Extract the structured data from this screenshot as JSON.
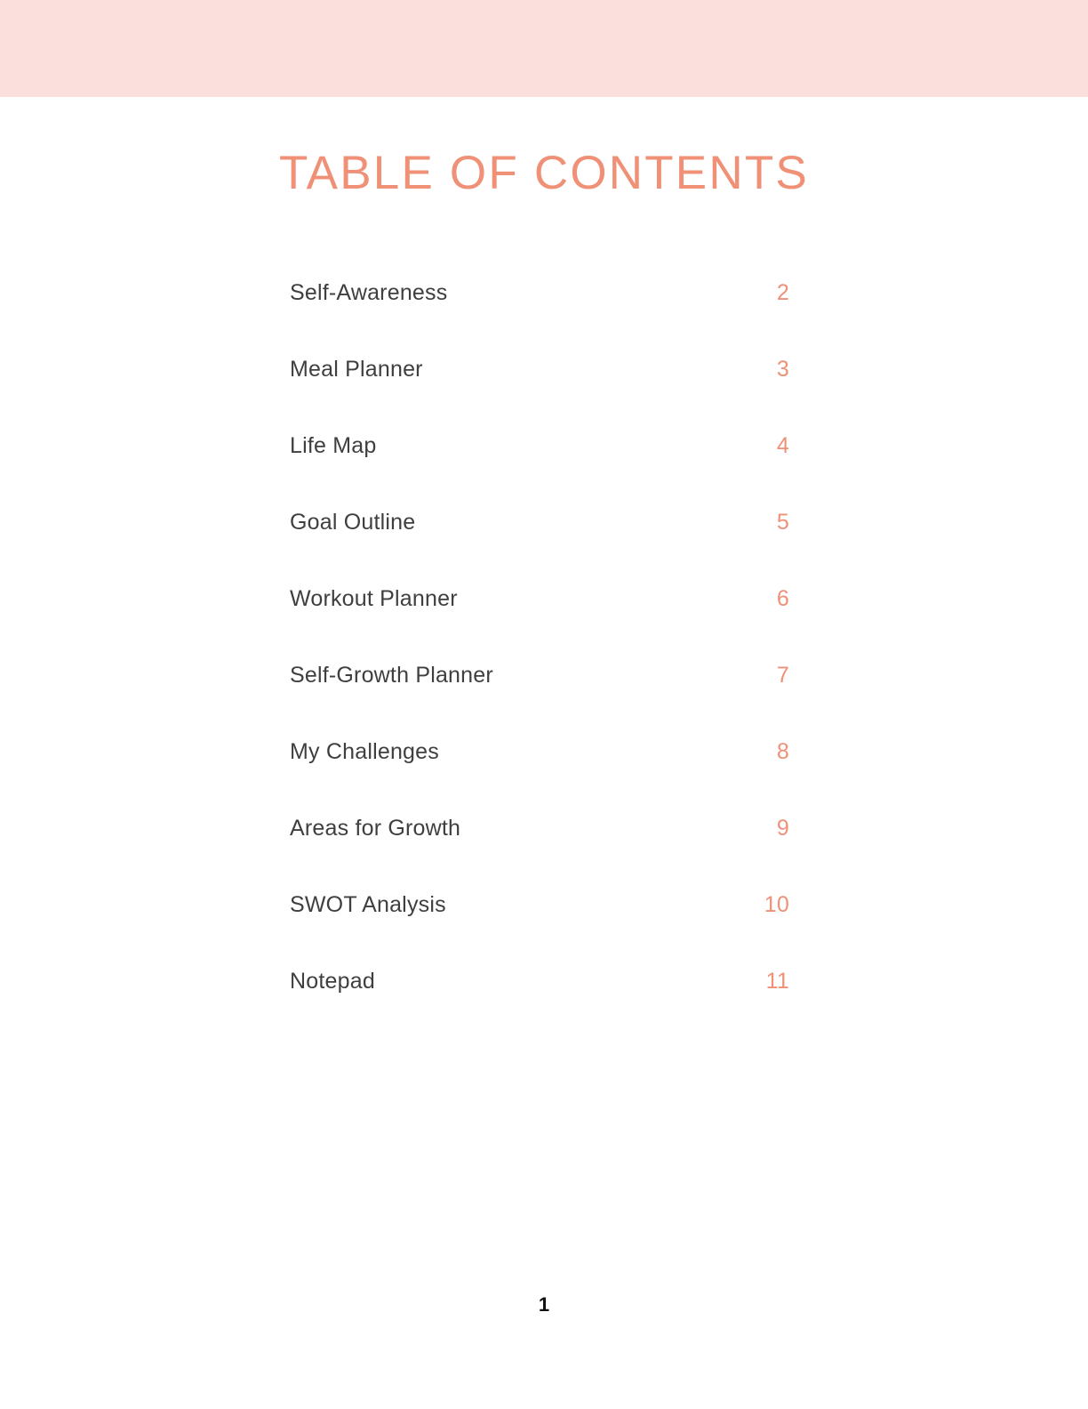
{
  "document": {
    "title": "TABLE OF CONTENTS",
    "page_number": "1"
  },
  "theme": {
    "banner_color": "#FBDFDC",
    "accent_color": "#EF9077",
    "label_color": "#3F3F3F",
    "background_color": "#FFFFFF"
  },
  "contents": {
    "entries": [
      {
        "label": "Self-Awareness",
        "page": "2"
      },
      {
        "label": "Meal Planner",
        "page": "3"
      },
      {
        "label": "Life Map",
        "page": "4"
      },
      {
        "label": "Goal Outline",
        "page": "5"
      },
      {
        "label": "Workout Planner",
        "page": "6"
      },
      {
        "label": "Self-Growth Planner",
        "page": "7"
      },
      {
        "label": "My Challenges",
        "page": "8"
      },
      {
        "label": "Areas for Growth",
        "page": "9"
      },
      {
        "label": "SWOT Analysis",
        "page": "10"
      },
      {
        "label": "Notepad",
        "page": "11"
      }
    ]
  }
}
